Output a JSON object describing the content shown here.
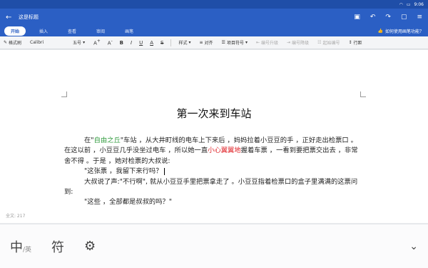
{
  "status": {
    "time_right": "9:06"
  },
  "titlebar": {
    "back_icon": "arrow-left-icon",
    "title": "这是标题"
  },
  "tabs": [
    {
      "label": "开始",
      "active": true
    },
    {
      "label": "插入",
      "active": false
    },
    {
      "label": "查看",
      "active": false
    },
    {
      "label": "审阅",
      "active": false
    },
    {
      "label": "画笔",
      "active": false
    }
  ],
  "help": {
    "label": "如何使用画笔功能？"
  },
  "toolbar": {
    "format_painter": "格式刷",
    "font_name": "Calibri",
    "font_size": "五号",
    "style": "样式",
    "align": "对齐",
    "bullets": "项目符号",
    "numbering_up": "编号升级",
    "numbering_down": "编号降级",
    "start_numbering": "起始编号",
    "line_spacing": "行距"
  },
  "document": {
    "heading": "第一次来到车站",
    "p1_a": "在\"",
    "p1_green": "自由之丘",
    "p1_b": "\"车站 ，从大井町线的电车上下来后 ，妈妈拉着小豆豆的手 ，正好走出检票口 。在这以前 ，小豆豆几乎没坐过电车 ，所以她一直",
    "p1_red": "小心翼翼地",
    "p1_c": "握着车票 ，一看到要把票交出去 ，非常舍不得 。于是 ，她对检票的大叔说:",
    "p2": "\"这张票 ，我留下来行吗？",
    "p3": "大叔说了声:\"不行啊\", 就从小豆豆手里把票拿走了 。小豆豆指着检票口的盒子里满满的这票问到:",
    "p4": "\"这些 ，全部都是叔叔的吗？\""
  },
  "wordcount": "全文: 217",
  "ime": {
    "zh": "中",
    "en": "/英",
    "symbol": "符"
  }
}
